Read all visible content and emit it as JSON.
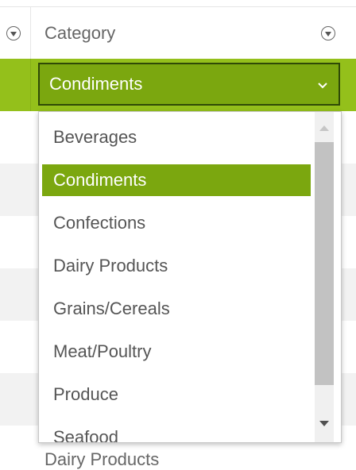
{
  "header": {
    "column_title": "Category",
    "left_filter_icon": "filter-icon",
    "right_filter_icon": "filter-icon"
  },
  "editor": {
    "selected_value": "Condiments",
    "caret_icon": "chevron-down-icon"
  },
  "dropdown": {
    "options": [
      {
        "label": "Beverages",
        "selected": false
      },
      {
        "label": "Condiments",
        "selected": true
      },
      {
        "label": "Confections",
        "selected": false
      },
      {
        "label": "Dairy Products",
        "selected": false
      },
      {
        "label": "Grains/Cereals",
        "selected": false
      },
      {
        "label": "Meat/Poultry",
        "selected": false
      },
      {
        "label": "Produce",
        "selected": false
      },
      {
        "label": "Seafood",
        "selected": false
      }
    ]
  },
  "grid": {
    "next_row_category": "Dairy Products"
  },
  "colors": {
    "row_selected": "#94c01b",
    "item_selected": "#7ba70f"
  }
}
